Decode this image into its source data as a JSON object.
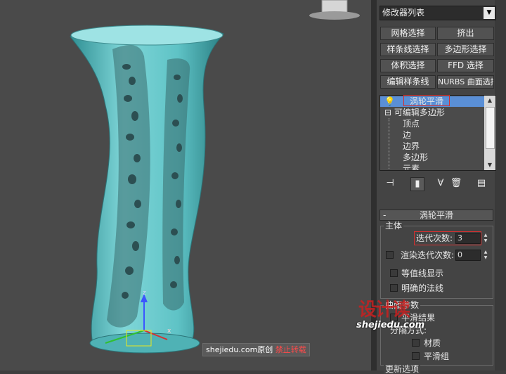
{
  "viewport": {
    "object_color": "#7fd6d8",
    "axis_labels": {
      "z": "z",
      "x": "x"
    },
    "watermark": {
      "text": "shejiedu.com原创",
      "warning": "禁止转载"
    },
    "logo": {
      "main": "设计读",
      "url": "shejiedu.com"
    }
  },
  "modifier_panel": {
    "dropdown_label": "修改器列表",
    "buttons": [
      {
        "label": "网格选择"
      },
      {
        "label": "挤出"
      },
      {
        "label": "样条线选择"
      },
      {
        "label": "多边形选择"
      },
      {
        "label": "体积选择"
      },
      {
        "label": "FFD 选择"
      },
      {
        "label": "编辑样条线"
      },
      {
        "label": "NURBS 曲面选择"
      }
    ],
    "stack": {
      "selected_modifier": "涡轮平滑",
      "base_object": "可编辑多边形",
      "sub_objects": [
        "顶点",
        "边",
        "边界",
        "多边形",
        "元素"
      ]
    },
    "rollout": {
      "title": "涡轮平滑",
      "main_group": "主体",
      "iterations_label": "迭代次数:",
      "iterations_value": "3",
      "render_iters_label": "渲染迭代次数:",
      "render_iters_value": "0",
      "isoline_label": "等值线显示",
      "explicit_normals_label": "明确的法线",
      "surface_group": "曲面参数",
      "smooth_result_label": "平滑结果",
      "separate_label": "分隔方式:",
      "material_label": "材质",
      "smoothing_group_label": "平滑组",
      "update_group": "更新选项"
    }
  }
}
